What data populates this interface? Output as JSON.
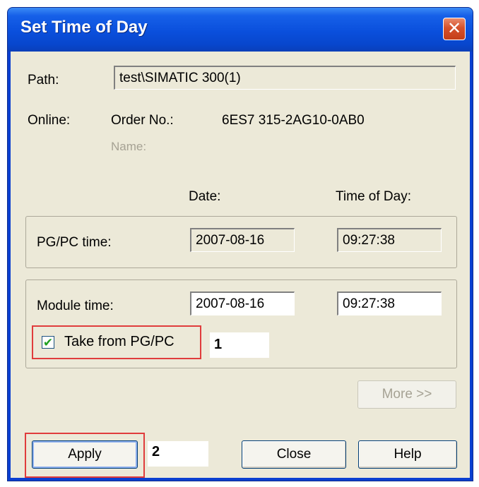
{
  "dialog": {
    "title": "Set Time of Day",
    "path_label": "Path:",
    "path_value": "test\\SIMATIC 300(1)",
    "online_label": "Online:",
    "order_label": "Order No.:",
    "order_value": "6ES7 315-2AG10-0AB0",
    "name_label": "Name:",
    "date_header": "Date:",
    "time_header": "Time of Day:",
    "pgpc": {
      "label": "PG/PC time:",
      "date": "2007-08-16",
      "time": "09:27:38"
    },
    "module": {
      "label": "Module time:",
      "date": "2007-08-16",
      "time": "09:27:38"
    },
    "take_from_pgpc": {
      "label": "Take from PG/PC",
      "checked": true,
      "check_glyph": "✔"
    },
    "buttons": {
      "more": "More >>",
      "apply": "Apply",
      "close": "Close",
      "help": "Help"
    }
  },
  "annotations": {
    "marker_1": "1",
    "marker_2": "2",
    "highlight_color": "#e03c3c"
  },
  "icons": {
    "close": "close-icon",
    "checkmark": "checkmark-icon"
  }
}
